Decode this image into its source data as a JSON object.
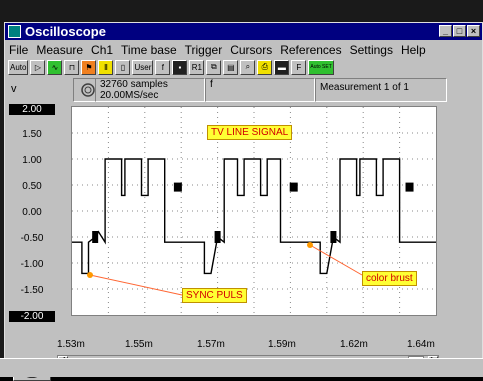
{
  "window": {
    "title": "Oscilloscope"
  },
  "menubar": {
    "items": [
      {
        "label": "File"
      },
      {
        "label": "Measure"
      },
      {
        "label": "Ch1"
      },
      {
        "label": "Time base"
      },
      {
        "label": "Trigger"
      },
      {
        "label": "Cursors"
      },
      {
        "label": "References"
      },
      {
        "label": "Settings"
      },
      {
        "label": "Help"
      }
    ]
  },
  "toolbar": {
    "auto_label": "Auto",
    "user_label": "User",
    "r1_label": "R1",
    "auto_set_label": "Auto SET",
    "trigger_symbol": "f",
    "freeze_symbol": "F"
  },
  "infobar": {
    "unit": "v",
    "samples": "32760 samples",
    "rate": "20.00MS/sec",
    "trigger_symbol": "f",
    "measurement": "Measurement 1 of 1"
  },
  "colors": {
    "titlebar": "#000080",
    "annotation_bg": "#ffff33",
    "annotation_text": "#d00000",
    "arrow": "#ff6633",
    "trace": "#000000"
  },
  "annotations": {
    "tv_line": "TV LINE SIGNAL",
    "sync": "SYNC PULS",
    "color_burst": "color brust"
  },
  "chart_data": {
    "type": "line",
    "title": "TV LINE SIGNAL",
    "ylabel": "v",
    "ylim": [
      -2.0,
      2.0
    ],
    "yticks": [
      "2.00",
      "1.50",
      "1.00",
      "0.50",
      "0.00",
      "-0.50",
      "-1.00",
      "-1.50",
      "-2.00"
    ],
    "xticks": [
      "1.53m",
      "1.55m",
      "1.57m",
      "1.59m",
      "1.62m",
      "1.64m"
    ],
    "xlim": [
      1.53,
      1.64
    ],
    "series": [
      {
        "x": [
          1.53,
          1.533,
          1.533,
          1.535,
          1.535,
          1.537,
          1.538,
          1.54,
          1.54,
          1.545,
          1.545,
          1.546,
          1.546,
          1.551,
          1.551,
          1.553,
          1.553,
          1.558,
          1.558,
          1.57,
          1.57,
          1.572,
          1.574,
          1.576,
          1.576,
          1.58,
          1.58,
          1.582,
          1.582,
          1.587,
          1.587,
          1.589,
          1.589,
          1.593,
          1.593,
          1.605,
          1.605,
          1.607,
          1.609,
          1.611,
          1.611,
          1.616,
          1.616,
          1.617,
          1.617,
          1.622,
          1.622,
          1.624,
          1.624,
          1.629,
          1.629,
          1.64
        ],
        "y": [
          -0.6,
          -0.6,
          -1.2,
          -1.2,
          -0.6,
          -0.5,
          -0.4,
          -0.6,
          1.0,
          1.0,
          0.3,
          0.3,
          1.0,
          1.0,
          0.3,
          0.3,
          1.0,
          1.0,
          -0.6,
          -0.6,
          -1.2,
          -1.2,
          -0.5,
          -0.6,
          1.0,
          1.0,
          0.3,
          0.3,
          1.0,
          1.0,
          0.3,
          0.3,
          1.0,
          1.0,
          -0.6,
          -0.6,
          -1.2,
          -1.2,
          -0.5,
          -0.6,
          1.0,
          1.0,
          0.3,
          0.3,
          1.0,
          1.0,
          0.3,
          0.3,
          1.0,
          1.0,
          -0.6,
          -0.6
        ]
      }
    ],
    "grid": true
  }
}
